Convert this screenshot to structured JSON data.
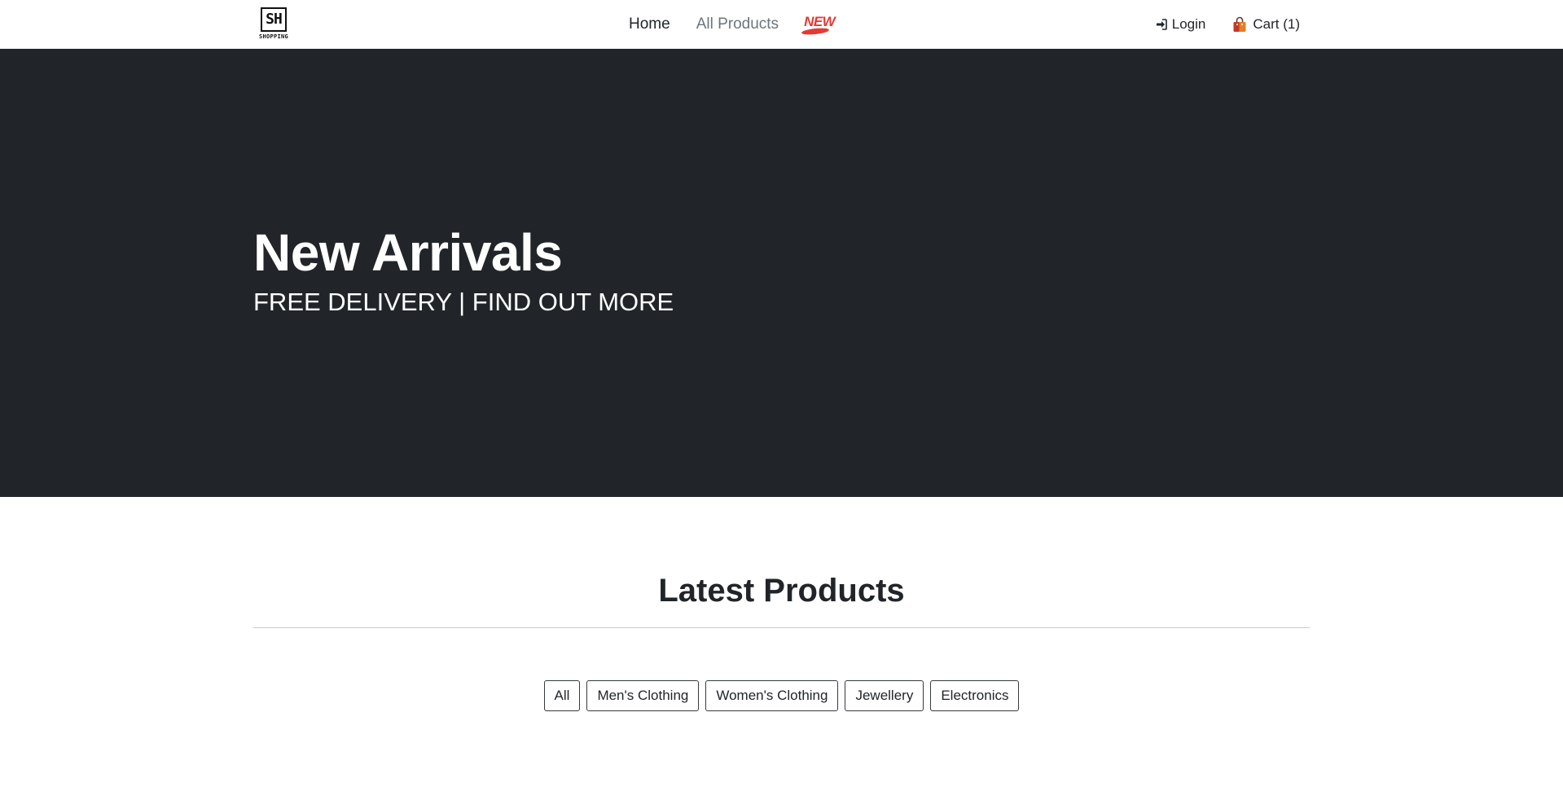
{
  "brand": {
    "logo_mark": "SH",
    "logo_text": "SHOPPING"
  },
  "nav": {
    "links": [
      {
        "label": "Home",
        "active": true
      },
      {
        "label": "All Products",
        "active": false
      }
    ],
    "new_badge": {
      "label": "NEW",
      "color": "#e53935"
    },
    "login": {
      "label": "Login",
      "icon": "sign-in-icon"
    },
    "cart": {
      "label": "Cart (1)",
      "icon": "shopping-bag-icon"
    }
  },
  "hero": {
    "title": "New Arrivals",
    "subtitle": "FREE DELIVERY | FIND OUT MORE",
    "background": "#212529"
  },
  "latest": {
    "title": "Latest Products",
    "filters": [
      "All",
      "Men's Clothing",
      "Women's Clothing",
      "Jewellery",
      "Electronics"
    ]
  }
}
